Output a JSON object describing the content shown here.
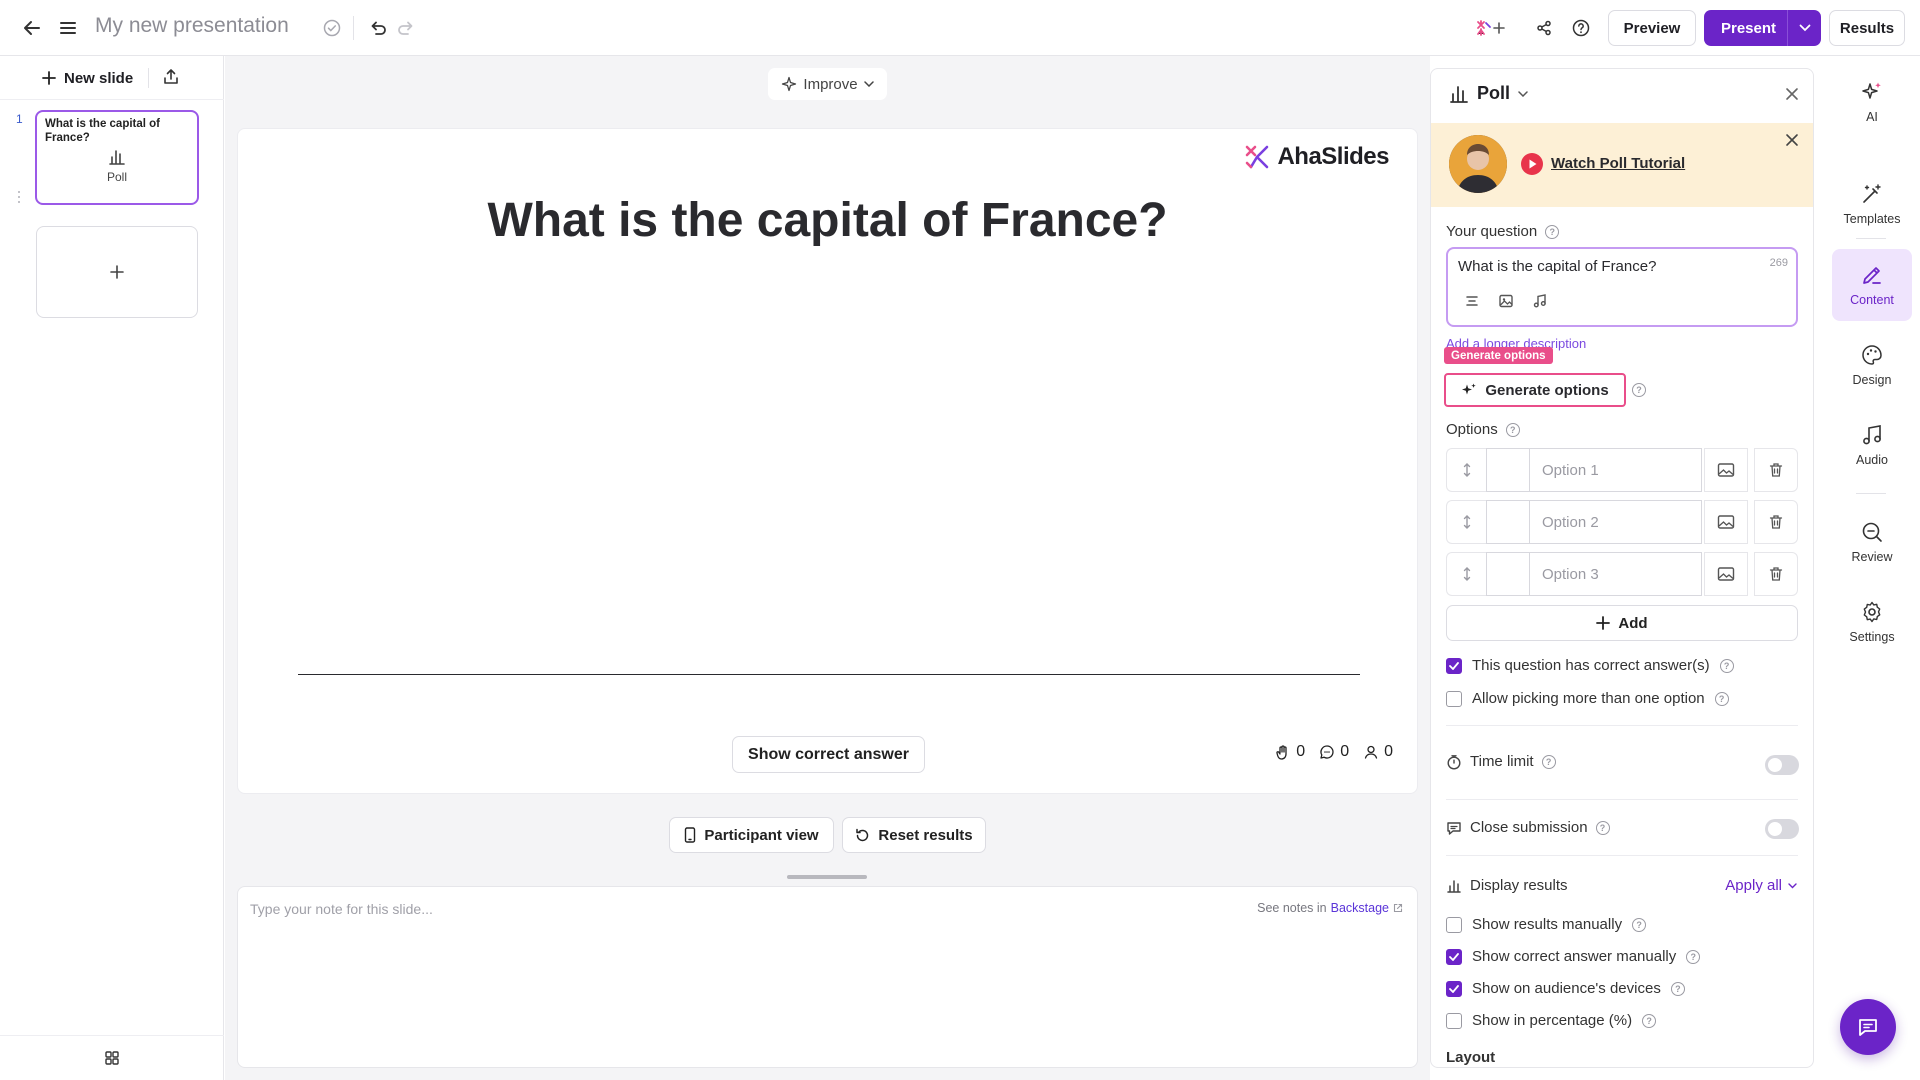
{
  "topbar": {
    "title": "My new presentation",
    "preview_label": "Preview",
    "present_label": "Present",
    "results_label": "Results"
  },
  "left_panel": {
    "new_slide_label": "New slide",
    "slides": [
      {
        "number": "1",
        "title": "What is the capital of France?",
        "type_label": "Poll"
      }
    ]
  },
  "editor": {
    "improve_label": "Improve",
    "brand_name": "AhaSlides",
    "heading": "What is the capital of France?",
    "show_answer_label": "Show correct answer",
    "stats": {
      "reactions": "0",
      "responses": "0",
      "participants": "0"
    },
    "participant_view_label": "Participant view",
    "reset_results_label": "Reset results",
    "notes_placeholder": "Type your note for this slide...",
    "notes_hint": "See notes in",
    "notes_link": "Backstage"
  },
  "content_panel": {
    "slide_type": "Poll",
    "tutorial_link": "Watch Poll Tutorial",
    "question_label": "Your question",
    "question_value": "What is the capital of France?",
    "char_count": "269",
    "longer_desc_label": "Add a longer description",
    "generate_tooltip": "Generate options",
    "generate_label": "Generate options",
    "options_label": "Options",
    "options": [
      {
        "placeholder": "Option 1"
      },
      {
        "placeholder": "Option 2"
      },
      {
        "placeholder": "Option 3"
      }
    ],
    "add_label": "Add",
    "has_correct_label": "This question has correct answer(s)",
    "has_correct_checked": true,
    "multi_pick_label": "Allow picking more than one option",
    "multi_pick_checked": false,
    "time_limit_label": "Time limit",
    "close_submission_label": "Close submission",
    "display_results_label": "Display results",
    "apply_all_label": "Apply all",
    "display_options": [
      {
        "label": "Show results manually",
        "checked": false
      },
      {
        "label": "Show correct answer manually",
        "checked": true
      },
      {
        "label": "Show on audience's devices",
        "checked": true
      },
      {
        "label": "Show in percentage (%)",
        "checked": false
      }
    ],
    "layout_label": "Layout"
  },
  "rail": {
    "items": [
      {
        "label": "AI",
        "icon": "sparkle-icon"
      },
      {
        "label": "Templates",
        "icon": "magic-wand-icon"
      },
      {
        "label": "Content",
        "icon": "pencil-icon"
      },
      {
        "label": "Design",
        "icon": "palette-icon"
      },
      {
        "label": "Audio",
        "icon": "music-note-icon"
      },
      {
        "label": "Review",
        "icon": "review-icon"
      },
      {
        "label": "Settings",
        "icon": "gear-icon"
      }
    ]
  },
  "colors": {
    "accent": "#6b24c8",
    "highlight": "#e94e8a",
    "banner": "#fdf0d6"
  }
}
